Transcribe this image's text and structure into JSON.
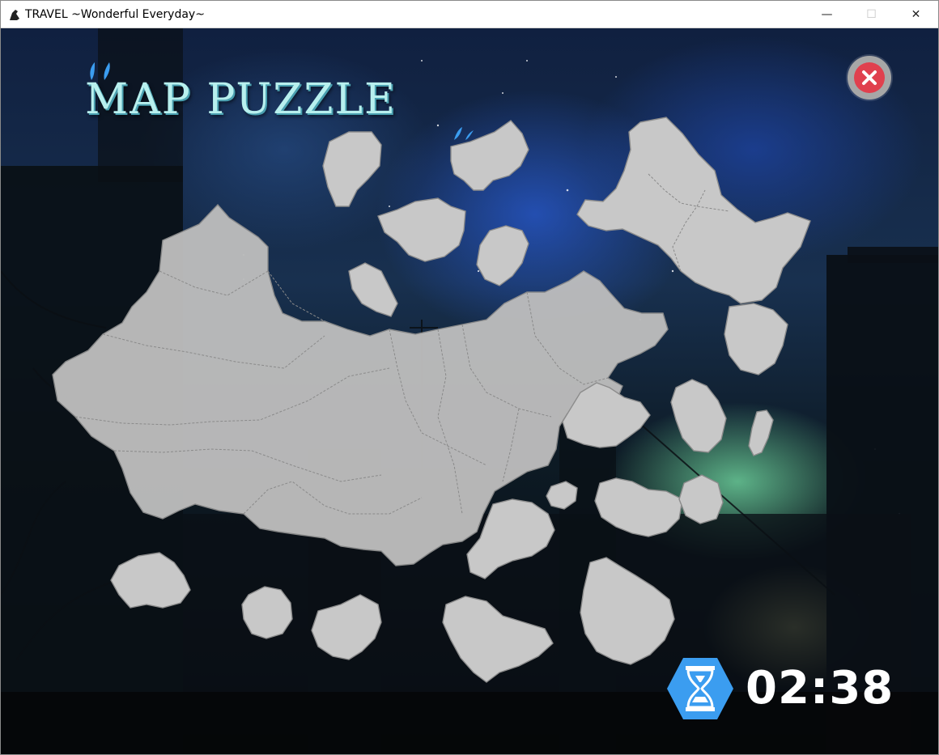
{
  "window": {
    "title": "TRAVEL ~Wonderful Everyday~",
    "minimize_glyph": "—",
    "maximize_glyph": "☐",
    "close_glyph": "✕"
  },
  "game": {
    "title": "MAP PUZZLE",
    "close_icon": "close-circle-icon",
    "timer_icon": "hourglass-icon",
    "timer": "02:38"
  },
  "colors": {
    "title_text": "#b8f0ee",
    "piece_fill": "#c8c8c8",
    "close_red": "#e0404e",
    "timer_blue": "#3b9df0"
  }
}
